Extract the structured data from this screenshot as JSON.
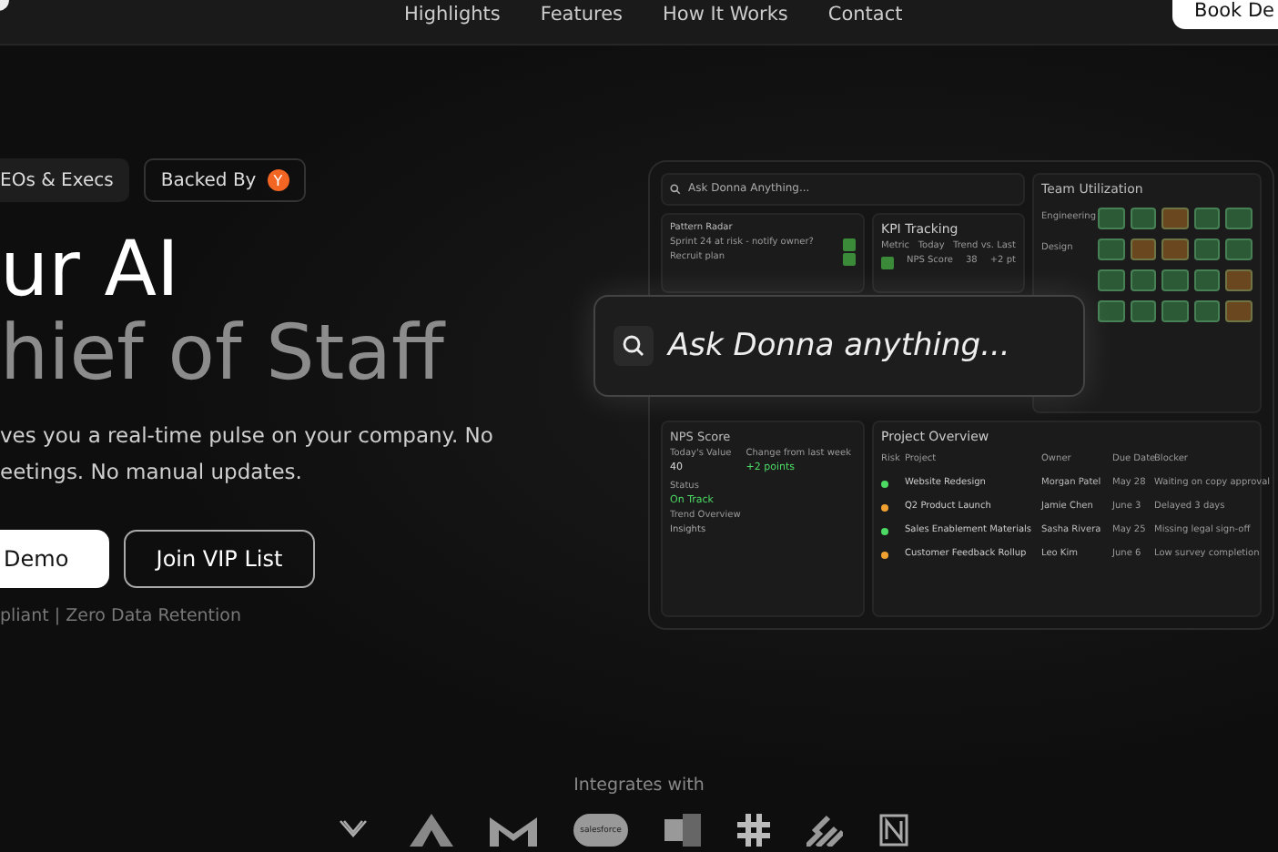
{
  "nav": {
    "links": [
      "Highlights",
      "Features",
      "How It Works",
      "Contact"
    ],
    "cta": "Book De"
  },
  "badges": [
    {
      "kind": "plain",
      "label": "EOs & Execs"
    },
    {
      "kind": "backer",
      "label": "Backed By",
      "mark": "Y"
    }
  ],
  "headline": {
    "line_1": "ur AI",
    "line_2": "hief of Staff"
  },
  "subtitle": [
    "ves you a real-time pulse on your company. No",
    "eetings. No manual updates."
  ],
  "buttons": [
    {
      "kind": "primary",
      "label": "Demo"
    },
    {
      "kind": "outline",
      "label": "Join VIP List"
    }
  ],
  "compliance": "pliant | Zero Data Retention",
  "dashboard": {
    "mini_search": "Ask Donna Anything...",
    "pattern_radar": {
      "title": "Pattern Radar",
      "items": [
        {
          "text": "Sprint 24 at risk - notify owner?",
          "checked": true
        },
        {
          "text": "Recruit plan",
          "checked": true
        }
      ]
    },
    "kpi": {
      "title": "KPI Tracking",
      "columns": [
        "Metric",
        "Today",
        "Trend vs. Last"
      ],
      "rows": [
        {
          "metric": "NPS Score",
          "today": "38",
          "trend": "+2 pt",
          "checked": true
        }
      ]
    },
    "team_utilization": {
      "title": "Team Utilization",
      "rows": [
        {
          "label": "Engineering",
          "cells": [
            {
              "color": "#2c5a36"
            },
            {
              "color": "#2c5a36"
            },
            {
              "color": "#6b4720"
            },
            {
              "color": "#2c5a36"
            },
            {
              "color": "#2c5a36"
            }
          ]
        },
        {
          "label": "Design",
          "cells": [
            {
              "color": "#2c5a36"
            },
            {
              "color": "#6b4720"
            },
            {
              "color": "#6b4720"
            },
            {
              "color": "#2c5a36"
            },
            {
              "color": "#2c5a36"
            }
          ]
        },
        {
          "cells": [
            {
              "color": "#2c5a36"
            },
            {
              "color": "#2c5a36"
            },
            {
              "color": "#2c5a36"
            },
            {
              "color": "#2c5a36"
            },
            {
              "color": "#6b4720"
            }
          ]
        },
        {
          "cells": [
            {
              "color": "#2c5a36"
            },
            {
              "color": "#2c5a36"
            },
            {
              "color": "#2c5a36"
            },
            {
              "color": "#2c5a36"
            },
            {
              "color": "#6b4720"
            }
          ]
        }
      ]
    },
    "nps": {
      "title": "NPS Score",
      "stats": [
        {
          "label": "Today's Value",
          "value": "40",
          "kind": "plain"
        },
        {
          "label": "Change from last week",
          "value": "+2 points",
          "kind": "good"
        },
        {
          "label": "Status",
          "value": "On Track",
          "kind": "good"
        }
      ],
      "trend_title": "Trend Overview",
      "insights": "Insights"
    },
    "projects": {
      "title": "Project Overview",
      "columns": [
        "Risk",
        "Project",
        "Owner",
        "Due Date",
        "Blocker"
      ],
      "rows": [
        {
          "color": "#4cd964",
          "project": "Website Redesign",
          "owner": "Morgan Patel",
          "due": "May 28",
          "blocker": "Waiting on copy approval"
        },
        {
          "color": "#f0a030",
          "project": "Q2 Product Launch",
          "owner": "Jamie Chen",
          "due": "June 3",
          "blocker": "Delayed 3 days"
        },
        {
          "color": "#4cd964",
          "project": "Sales Enablement Materials",
          "owner": "Sasha Rivera",
          "due": "May 25",
          "blocker": "Missing legal sign-off"
        },
        {
          "color": "#f0a030",
          "project": "Customer Feedback Rollup",
          "owner": "Leo Kim",
          "due": "June 6",
          "blocker": "Low survey completion"
        }
      ]
    }
  },
  "ask_bar": {
    "placeholder": "Ask Donna anything..."
  },
  "integrations": {
    "title": "Integrates with",
    "salesforce": "salesforce"
  }
}
